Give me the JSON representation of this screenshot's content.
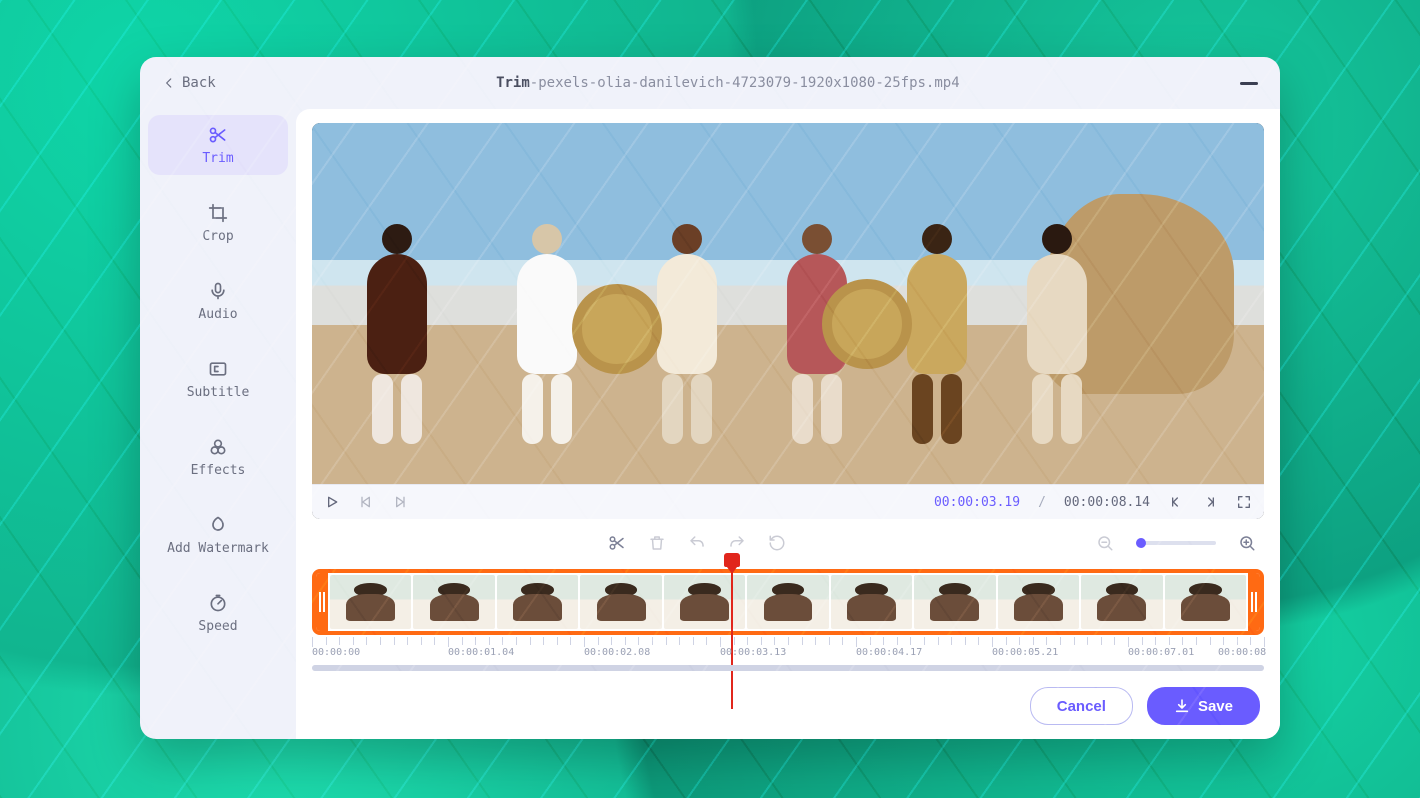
{
  "header": {
    "back_label": "Back",
    "title_prefix": "Trim",
    "title_suffix": "-pexels-olia-danilevich-4723079-1920x1080-25fps.mp4"
  },
  "sidebar": {
    "items": [
      {
        "label": "Trim",
        "icon": "scissors",
        "active": true
      },
      {
        "label": "Crop",
        "icon": "crop",
        "active": false
      },
      {
        "label": "Audio",
        "icon": "mic",
        "active": false
      },
      {
        "label": "Subtitle",
        "icon": "subtitle",
        "active": false
      },
      {
        "label": "Effects",
        "icon": "effects",
        "active": false
      },
      {
        "label": "Add Watermark",
        "icon": "watermark",
        "active": false
      },
      {
        "label": "Speed",
        "icon": "speed",
        "active": false
      }
    ]
  },
  "player": {
    "current_time": "00:00:03.19",
    "separator": "/",
    "total_time": "00:00:08.14"
  },
  "timeline": {
    "ticks": [
      "00:00:00",
      "00:00:01.04",
      "00:00:02.08",
      "00:00:03.13",
      "00:00:04.17",
      "00:00:05.21",
      "00:00:07.01",
      "00:00:08"
    ],
    "playhead_pct": 44
  },
  "footer": {
    "cancel_label": "Cancel",
    "save_label": "Save"
  }
}
